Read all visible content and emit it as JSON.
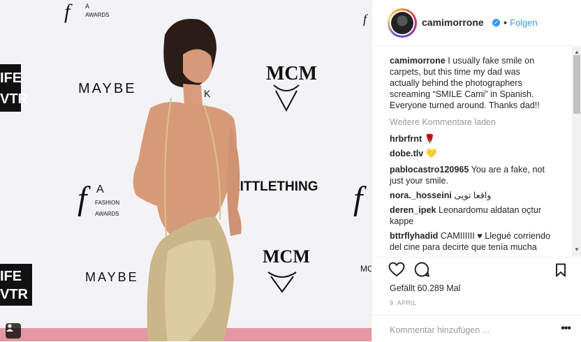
{
  "post_header": {
    "username": "camimorrone",
    "verified_icon": "verified-badge-icon",
    "separator": "•",
    "follow_label": "Folgen"
  },
  "caption": {
    "username": "camimorrone",
    "text": "I usually fake smile on carpets, but this time my dad was actually behind the photographers screaming “SMILE Cami” in Spanish. Everyone turned around. Thanks dad!!"
  },
  "load_more_label": "Weitere Kommentare laden",
  "comments": [
    {
      "username": "hrbrfrnt",
      "text": "🌹"
    },
    {
      "username": "dobe.tlv",
      "text": "💛"
    },
    {
      "username": "pablocastro120965",
      "text": "You are a fake, not just your smile."
    },
    {
      "username": "nora._hosseini",
      "text": "واقعا توپی"
    },
    {
      "username": "deren_ipek",
      "text": "Leonardomu aldatan oçtur kappe"
    },
    {
      "username": "bttrflyhadid",
      "text": "CAMIIIIII ♥ Llegué corriendo del cine para decirte que tenía mucha"
    }
  ],
  "actions": {
    "like_icon": "heart-icon",
    "comment_icon": "comment-bubble-icon",
    "save_icon": "bookmark-icon"
  },
  "likes_text": "Gefällt 60.289 Mal",
  "date_text": "9. APRIL",
  "add_comment_placeholder": "Kommentar hinzufügen ...",
  "options_label": "•••",
  "photo_backdrop": {
    "logos": [
      "MCM",
      "MAYBE",
      "fLA FASHION AWARDS",
      "LITTLETHING",
      "IFE VTR",
      "MC"
    ],
    "fla_top": "f|A",
    "fashion": "FASHION",
    "awards": "AWARDS",
    "maybelline": "MAYBE",
    "k": "K",
    "mcm": "MCM",
    "littlething": "LITTLETHING",
    "ife": "IFE",
    "vtr": "VTR",
    "mc": "MC",
    "tag_icon": "user-tag-icon"
  },
  "colors": {
    "link_blue": "#3897f0",
    "text": "#262626",
    "muted": "#999999",
    "border": "#efefef"
  }
}
